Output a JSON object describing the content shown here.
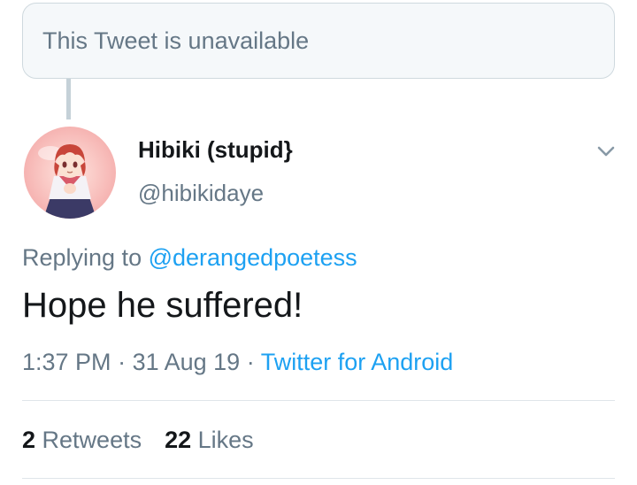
{
  "quoted": {
    "unavailable_text": "This Tweet is unavailable"
  },
  "tweet": {
    "display_name": "Hibiki (stupid}",
    "handle": "@hibikidaye",
    "replying_prefix": "Replying to ",
    "replying_to": "@derangedpoetess",
    "text": "Hope he suffered!",
    "time": "1:37 PM",
    "separator": " · ",
    "date": "31 Aug 19",
    "source": "Twitter for Android",
    "avatar_icon": "avatar-anime-girl",
    "caret_icon": "chevron-down-icon"
  },
  "stats": {
    "retweets_count": "2",
    "retweets_label": " Retweets",
    "likes_count": "22",
    "likes_label": " Likes"
  },
  "colors": {
    "text_primary": "#14171a",
    "text_secondary": "#657786",
    "link": "#1da1f2",
    "border": "#cfd9de"
  }
}
